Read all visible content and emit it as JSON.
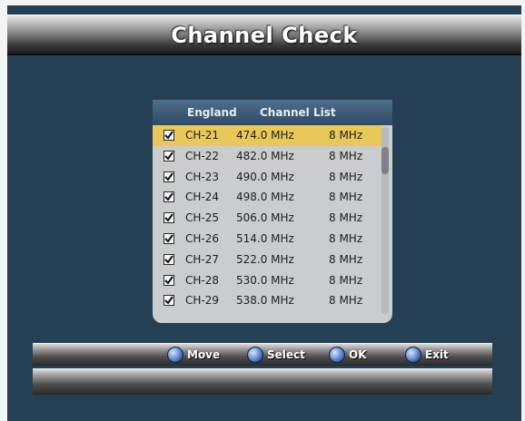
{
  "header": {
    "title": "Channel Check"
  },
  "channel_list": {
    "header_region": "England",
    "header_title": "Channel List",
    "rows": [
      {
        "channel": "CH-21",
        "frequency": "474.0 MHz",
        "bandwidth": "8 MHz",
        "checked": true,
        "selected": true
      },
      {
        "channel": "CH-22",
        "frequency": "482.0 MHz",
        "bandwidth": "8 MHz",
        "checked": true,
        "selected": false
      },
      {
        "channel": "CH-23",
        "frequency": "490.0 MHz",
        "bandwidth": "8 MHz",
        "checked": true,
        "selected": false
      },
      {
        "channel": "CH-24",
        "frequency": "498.0 MHz",
        "bandwidth": "8 MHz",
        "checked": true,
        "selected": false
      },
      {
        "channel": "CH-25",
        "frequency": "506.0 MHz",
        "bandwidth": "8 MHz",
        "checked": true,
        "selected": false
      },
      {
        "channel": "CH-26",
        "frequency": "514.0 MHz",
        "bandwidth": "8 MHz",
        "checked": true,
        "selected": false
      },
      {
        "channel": "CH-27",
        "frequency": "522.0 MHz",
        "bandwidth": "8 MHz",
        "checked": true,
        "selected": false
      },
      {
        "channel": "CH-28",
        "frequency": "530.0 MHz",
        "bandwidth": "8 MHz",
        "checked": true,
        "selected": false
      },
      {
        "channel": "CH-29",
        "frequency": "538.0 MHz",
        "bandwidth": "8 MHz",
        "checked": true,
        "selected": false
      }
    ]
  },
  "hints": [
    {
      "icon": "move-icon",
      "label": "Move"
    },
    {
      "icon": "select-icon",
      "label": "Select"
    },
    {
      "icon": "ok-icon",
      "label": "OK"
    },
    {
      "icon": "exit-icon",
      "label": "Exit"
    }
  ],
  "colors": {
    "background": "#253f54",
    "highlight": "#e8c85a",
    "panel": "#c9cdd0"
  }
}
